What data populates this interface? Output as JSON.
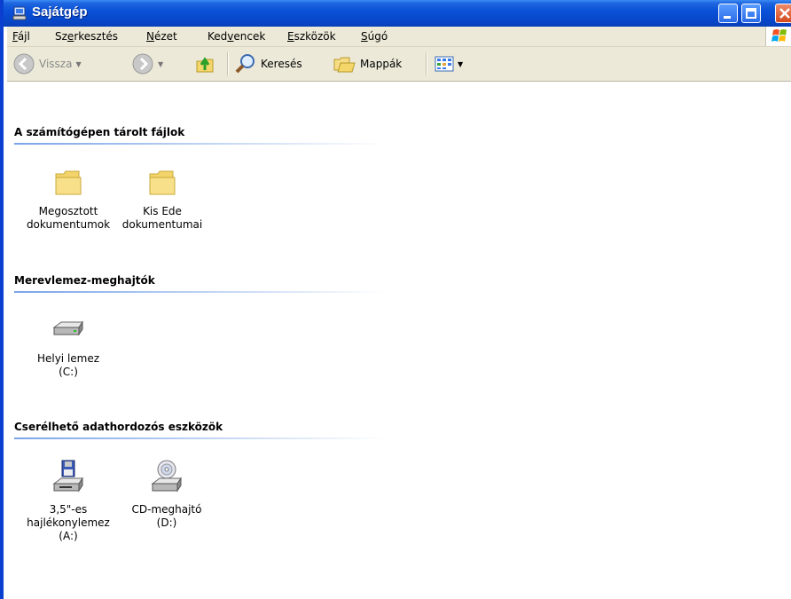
{
  "window": {
    "title": "Sajátgép"
  },
  "menu": {
    "items": [
      {
        "pre": "",
        "u": "F",
        "post": "ájl"
      },
      {
        "pre": "Sz",
        "u": "e",
        "post": "rkesztés"
      },
      {
        "pre": "",
        "u": "N",
        "post": "ézet"
      },
      {
        "pre": "Ked",
        "u": "v",
        "post": "encek"
      },
      {
        "pre": "",
        "u": "E",
        "post": "szközök"
      },
      {
        "pre": "",
        "u": "S",
        "post": "úgó"
      }
    ]
  },
  "toolbar": {
    "back_label": "Vissza",
    "search_label": "Keresés",
    "folders_label": "Mappák"
  },
  "groups": [
    {
      "header": "A számítógépen tárolt fájlok",
      "items": [
        {
          "line1": "Megosztott",
          "line2": "dokumentumok",
          "line3": "",
          "icon": "folder-icon"
        },
        {
          "line1": "Kis Ede",
          "line2": "dokumentumai",
          "line3": "",
          "icon": "folder-icon"
        }
      ]
    },
    {
      "header": "Merevlemez-meghajtók",
      "items": [
        {
          "line1": "Helyi lemez",
          "line2": "(C:)",
          "line3": "",
          "icon": "hard-drive-icon"
        }
      ]
    },
    {
      "header": "Cserélhető adathordozós eszközök",
      "items": [
        {
          "line1": "3,5\"-es",
          "line2": "hajlékonylemez",
          "line3": "(A:)",
          "icon": "floppy-drive-icon"
        },
        {
          "line1": "CD-meghajtó",
          "line2": "(D:)",
          "line3": "",
          "icon": "cd-drive-icon"
        }
      ]
    }
  ]
}
